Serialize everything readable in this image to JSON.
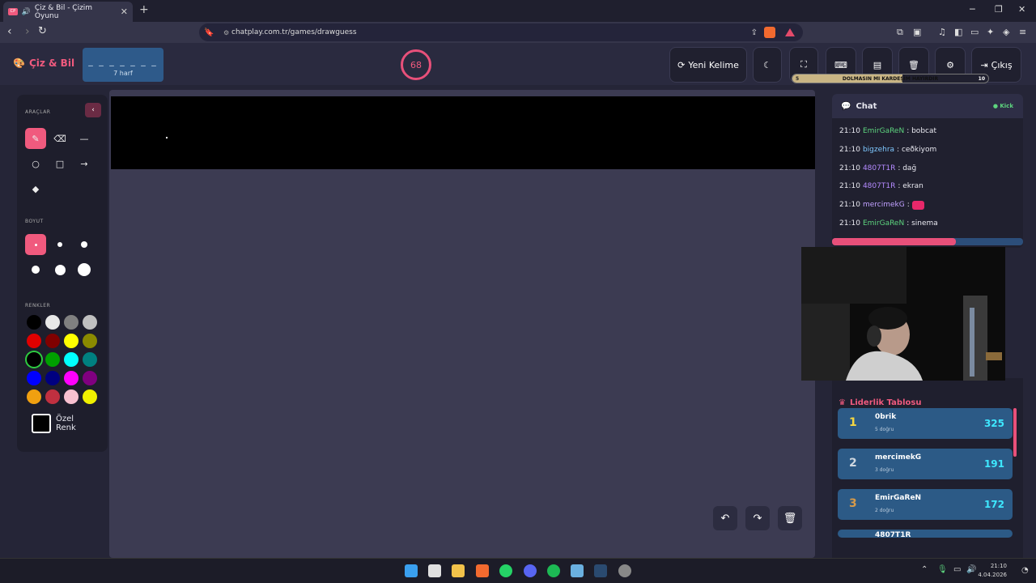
{
  "browser": {
    "tab_title": "Çiz & Bil - Çizim Oyunu",
    "tab_favicon_text": "CP",
    "url": "chatplay.com.tr/games/drawguess"
  },
  "header": {
    "logo": "Çiz & Bil",
    "word_dashes": "_ _ _ _ _ _ _",
    "word_hint": "7 harf",
    "timer": "68",
    "new_word": "Yeni Kelime",
    "exit": "Çıkış",
    "progress_left": "5",
    "progress_text": "DOLMASIN MI KARDEŞİM HAYIRDIR",
    "progress_right": "10",
    "progress_fraction": 0.56
  },
  "tools": {
    "title": "ARAÇLAR",
    "size_title": "BOYUT",
    "colors_title": "RENKLER",
    "custom_line1": "Özel",
    "custom_line2": "Renk",
    "colors": [
      "#000000",
      "#e8e8e8",
      "#808080",
      "#c0c0c0",
      "#e00000",
      "#800000",
      "#ffff00",
      "#8a8a00",
      "#000000",
      "#00a000",
      "#00ffff",
      "#008080",
      "#0000ff",
      "#000080",
      "#ff00ff",
      "#800080",
      "#f0a010",
      "#c03040",
      "#f8c0d0",
      "#f0f000"
    ],
    "selected_color_index": 8
  },
  "chat": {
    "title": "Chat",
    "kick": "Kick",
    "messages": [
      {
        "time": "21:10",
        "user": "EmirGaReN",
        "text": ": bobcat"
      },
      {
        "time": "21:10",
        "user": "bigzehra",
        "text": ": ceðkiyom"
      },
      {
        "time": "21:10",
        "user": "4807T1R",
        "text": ": dağ"
      },
      {
        "time": "21:10",
        "user": "4807T1R",
        "text": ": ekran"
      },
      {
        "time": "21:10",
        "user": "mercimekG",
        "text": ":"
      },
      {
        "time": "21:10",
        "user": "EmirGaReN",
        "text": ": sinema"
      }
    ],
    "bar_fraction": 0.65
  },
  "leaderboard": {
    "title": "Liderlik Tablosu",
    "rows": [
      {
        "rank": "1",
        "name": "0brik",
        "sub": "5 doğru",
        "score": "325"
      },
      {
        "rank": "2",
        "name": "mercimekG",
        "sub": "3 doğru",
        "score": "191"
      },
      {
        "rank": "3",
        "name": "EmirGaReN",
        "sub": "2 doğru",
        "score": "172"
      },
      {
        "rank": "4",
        "name": "4807T1R",
        "sub": "",
        "score": ""
      }
    ]
  },
  "taskbar": {
    "time": "21:10",
    "date": "4.04.2026"
  }
}
